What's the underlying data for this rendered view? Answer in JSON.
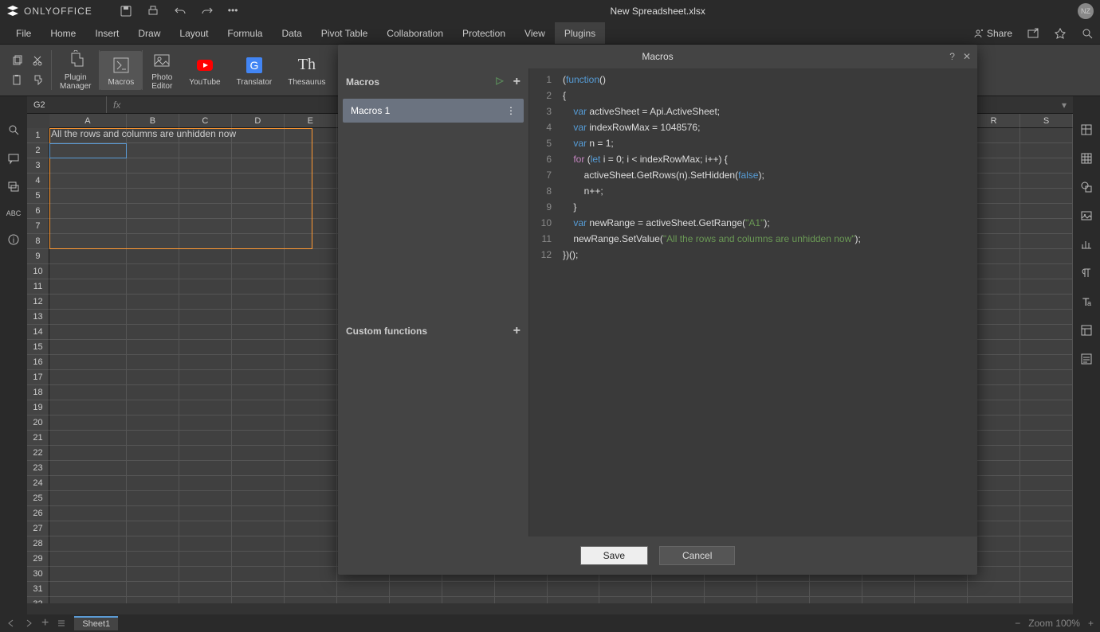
{
  "title": "New Spreadsheet.xlsx",
  "logo_text": "ONLYOFFICE",
  "avatar": "NZ",
  "tabs": [
    "File",
    "Home",
    "Insert",
    "Draw",
    "Layout",
    "Formula",
    "Data",
    "Pivot Table",
    "Collaboration",
    "Protection",
    "View",
    "Plugins"
  ],
  "active_tab": "Plugins",
  "share_label": "Share",
  "ribbon": {
    "plugin_manager": "Plugin\nManager",
    "macros": "Macros",
    "photo_editor": "Photo\nEditor",
    "youtube": "YouTube",
    "translator": "Translator",
    "thesaurus": "Thesaurus"
  },
  "name_box": "G2",
  "fx_label": "fx",
  "cell_a1": "All the rows and columns are unhidden now",
  "columns": [
    "A",
    "B",
    "C",
    "D",
    "E",
    "R",
    "S"
  ],
  "rows_count": 32,
  "sheet_tab": "Sheet1",
  "zoom_label": "Zoom 100%",
  "dialog": {
    "title": "Macros",
    "macros_label": "Macros",
    "macros_item": "Macros 1",
    "custom_fn_label": "Custom functions",
    "save": "Save",
    "cancel": "Cancel",
    "code_lines": 12
  },
  "code": {
    "l1": "(function()",
    "l2": "{",
    "l3_var": "var",
    "l3_rest": " activeSheet = Api.ActiveSheet;",
    "l4_var": "var",
    "l4_rest": " indexRowMax = 1048576;",
    "l5_var": "var",
    "l5_rest": " n = 1;",
    "l6_for": "for",
    "l6_let": "let",
    "l6_rest1": " i = 0; i < indexRowMax; i++) {",
    "l7": "        activeSheet.GetRows(n).SetHidden(",
    "l7_false": "false",
    "l7_end": ");",
    "l8": "        n++;",
    "l9": "    }",
    "l10_var": "var",
    "l10_rest": " newRange = activeSheet.GetRange(",
    "l10_str": "\"A1\"",
    "l10_end": ");",
    "l11": "    newRange.SetValue(",
    "l11_str": "\"All the rows and columns are unhidden now\"",
    "l11_end": ");",
    "l12": "})();"
  }
}
